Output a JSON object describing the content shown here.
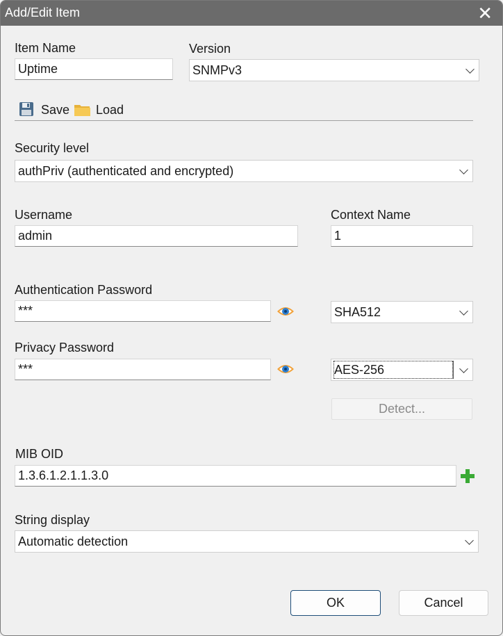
{
  "window": {
    "title": "Add/Edit Item",
    "close_glyph": "✕"
  },
  "item_name": {
    "label": "Item Name",
    "value": "Uptime"
  },
  "version": {
    "label": "Version",
    "value": "SNMPv3"
  },
  "toolbar": {
    "save_label": "Save",
    "load_label": "Load",
    "save_icon": "floppy-disk-icon",
    "load_icon": "folder-icon"
  },
  "security_level": {
    "label": "Security level",
    "value": "authPriv (authenticated and encrypted)"
  },
  "username": {
    "label": "Username",
    "value": "admin"
  },
  "context_name": {
    "label": "Context Name",
    "value": "1"
  },
  "auth": {
    "label": "Authentication Password",
    "value": "***",
    "protocol": "SHA512"
  },
  "privacy": {
    "label": "Privacy Password",
    "value": "***",
    "protocol": "AES-256"
  },
  "detect_label": "Detect...",
  "mib_oid": {
    "label": "MIB OID",
    "value": "1.3.6.1.2.1.1.3.0"
  },
  "string_display": {
    "label": "String display",
    "value": "Automatic detection"
  },
  "buttons": {
    "ok": "OK",
    "cancel": "Cancel"
  },
  "colors": {
    "titlebar": "#6b6b6b",
    "eye_blue": "#2e7fd0",
    "eye_orange": "#f2a23a",
    "plus_green": "#3aaa35",
    "primary_border": "#1f4e79"
  }
}
